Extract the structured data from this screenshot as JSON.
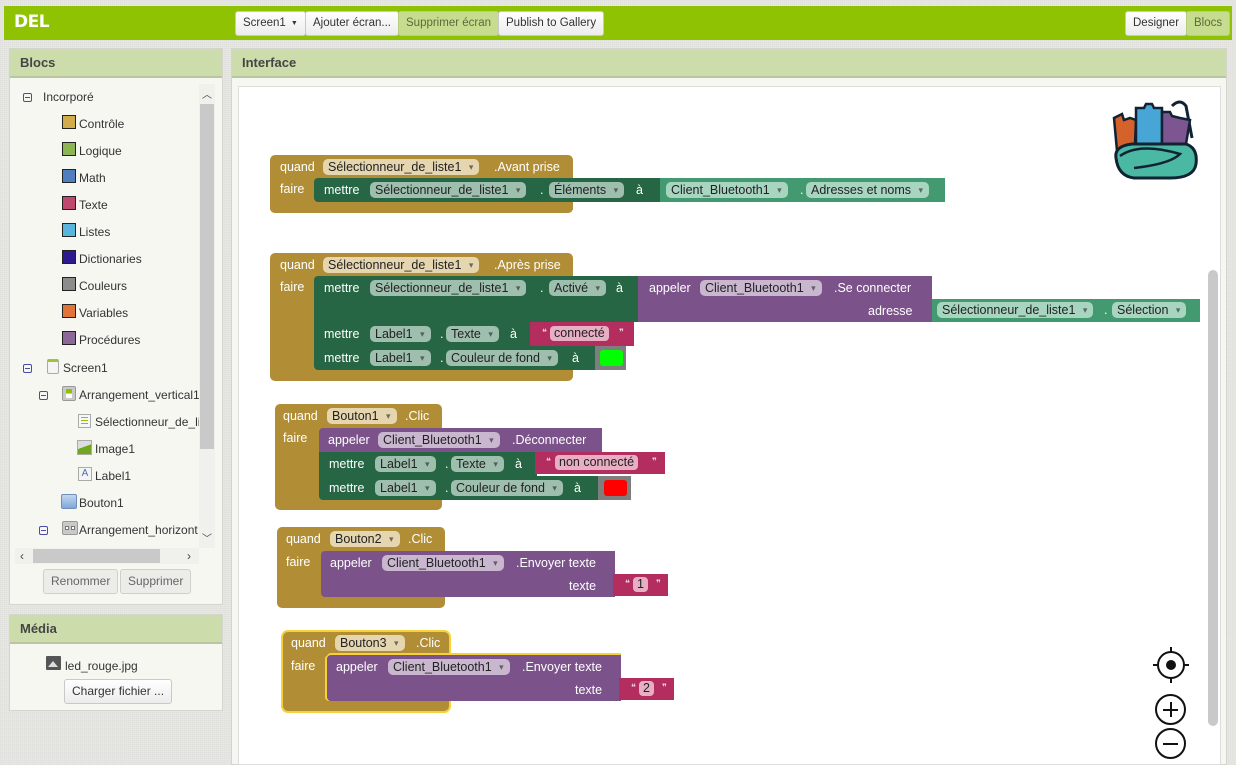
{
  "app": {
    "title": "DEL"
  },
  "toolbar": {
    "screen_select": "Screen1",
    "add_screen": "Ajouter écran...",
    "remove_screen": "Supprimer écran",
    "publish": "Publish to Gallery",
    "designer": "Designer",
    "blocks": "Blocs"
  },
  "blocks_panel": {
    "title": "Blocs",
    "builtin": {
      "label": "Incorporé",
      "items": [
        {
          "label": "Contrôle",
          "color": "#d1ac4a"
        },
        {
          "label": "Logique",
          "color": "#8db553"
        },
        {
          "label": "Math",
          "color": "#4f7fbf"
        },
        {
          "label": "Texte",
          "color": "#c0476e"
        },
        {
          "label": "Listes",
          "color": "#59b5dc"
        },
        {
          "label": "Dictionaries",
          "color": "#2e1a8f"
        },
        {
          "label": "Couleurs",
          "color": "#8c8c8c"
        },
        {
          "label": "Variables",
          "color": "#e0753a"
        },
        {
          "label": "Procédures",
          "color": "#8c6899"
        }
      ]
    },
    "components": {
      "screen": "Screen1",
      "vertical": "Arrangement_vertical1",
      "listpicker": "Sélectionneur_de_li",
      "image": "Image1",
      "label": "Label1",
      "button": "Bouton1",
      "horizontal": "Arrangement_horizont"
    },
    "rename": "Renommer",
    "delete": "Supprimer"
  },
  "media_panel": {
    "title": "Média",
    "file": "led_rouge.jpg",
    "upload": "Charger fichier ..."
  },
  "workspace": {
    "title": "Interface",
    "kw": {
      "when": "quand",
      "do": "faire",
      "set": "mettre",
      "call": "appeler",
      "to": "à",
      "dot": "."
    },
    "block1": {
      "component": "Sélectionneur_de_liste1",
      "event": ".Avant prise",
      "set_component": "Sélectionneur_de_liste1",
      "set_property": "Éléments",
      "get_component": "Client_Bluetooth1",
      "get_property": "Adresses et noms"
    },
    "block2": {
      "component": "Sélectionneur_de_liste1",
      "event": ".Après prise",
      "s1_component": "Sélectionneur_de_liste1",
      "s1_property": "Activé",
      "call_component": "Client_Bluetooth1",
      "call_method": ".Se connecter",
      "arg_label": "adresse",
      "arg_component": "Sélectionneur_de_liste1",
      "arg_property": "Sélection",
      "s2_component": "Label1",
      "s2_property": "Texte",
      "s2_value": "connecté",
      "s3_component": "Label1",
      "s3_property": "Couleur de fond",
      "s3_color": "#00ff00"
    },
    "block3": {
      "component": "Bouton1",
      "event": ".Clic",
      "call_component": "Client_Bluetooth1",
      "call_method": ".Déconnecter",
      "s1_component": "Label1",
      "s1_property": "Texte",
      "s1_value": "non connecté",
      "s2_component": "Label1",
      "s2_property": "Couleur de fond",
      "s2_color": "#ff0000"
    },
    "block4": {
      "component": "Bouton2",
      "event": ".Clic",
      "call_component": "Client_Bluetooth1",
      "call_method": ".Envoyer texte",
      "arg_label": "texte",
      "arg_value": "1"
    },
    "block5": {
      "component": "Bouton3",
      "event": ".Clic",
      "call_component": "Client_Bluetooth1",
      "call_method": ".Envoyer texte",
      "arg_label": "texte",
      "arg_value": "2"
    }
  }
}
